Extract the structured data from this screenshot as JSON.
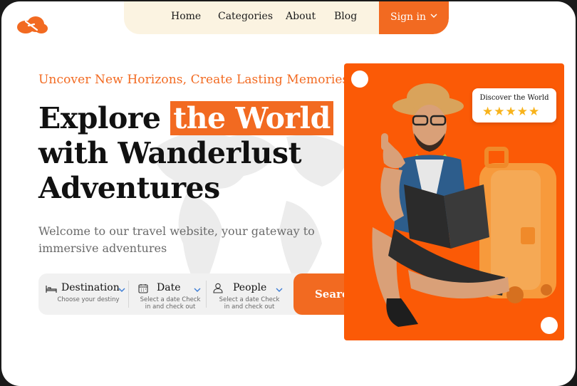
{
  "nav": {
    "items": [
      "Home",
      "Categories",
      "About",
      "Blog"
    ],
    "signin_label": "Sign in"
  },
  "hero": {
    "tagline": "Uncover New Horizons, Create Lasting Memories",
    "headline_pre": "Explore",
    "headline_highlight": "the World",
    "headline_line2": "with Wanderlust",
    "headline_line3": "Adventures",
    "subtitle": "Welcome to our travel website, your gateway to immersive adventures"
  },
  "search": {
    "destination": {
      "title": "Destination",
      "sub": "Choose your destiny"
    },
    "date": {
      "title": "Date",
      "sub": "Select a date Check in and check out"
    },
    "people": {
      "title": "People",
      "sub": "Select a date Check in and check out"
    },
    "button_label": "Search"
  },
  "badge": {
    "title": "Discover the World",
    "stars": "★★★★★",
    "rating": 5
  },
  "colors": {
    "accent": "#f26a21",
    "hero_bg": "#fb5a06",
    "nav_bg": "#fbf3e1",
    "star": "#f8b31b"
  },
  "icons": [
    "logo-icon",
    "chevron-down-icon",
    "bed-icon",
    "calendar-icon",
    "person-icon"
  ]
}
